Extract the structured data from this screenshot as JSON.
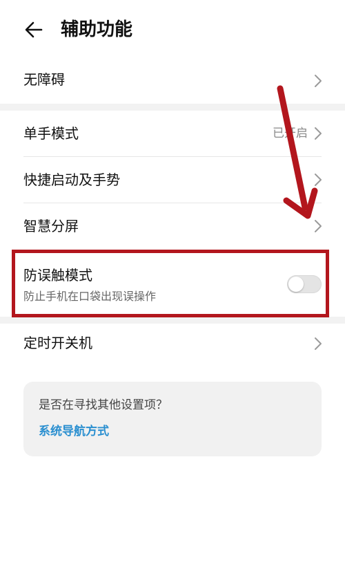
{
  "header": {
    "title": "辅助功能",
    "back_icon": "arrow-left-icon"
  },
  "items": [
    {
      "label": "无障碍"
    },
    {
      "label": "单手模式",
      "status": "已开启"
    },
    {
      "label": "快捷启动及手势"
    },
    {
      "label": "智慧分屏"
    },
    {
      "label": "防误触模式",
      "sublabel": "防止手机在口袋出现误操作",
      "toggle": false
    },
    {
      "label": "定时开关机"
    }
  ],
  "suggestion": {
    "question": "是否在寻找其他设置项？",
    "link": "系统导航方式"
  },
  "colors": {
    "accent_link": "#2a8fd0",
    "annotation_red": "#b3161d"
  }
}
